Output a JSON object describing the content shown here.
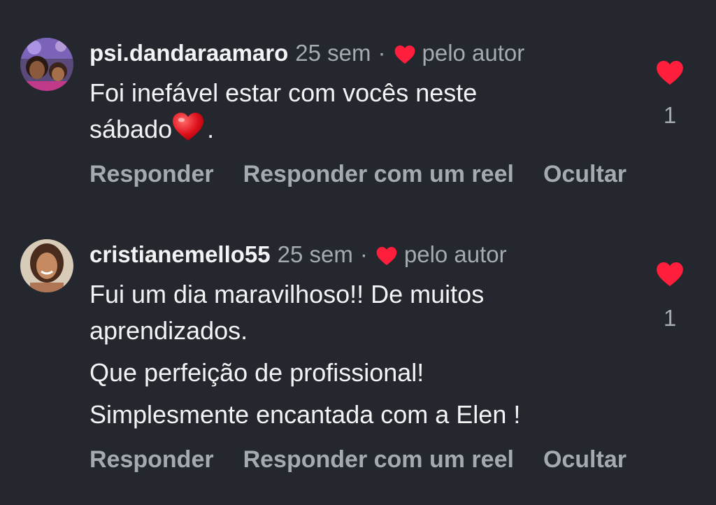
{
  "comments": [
    {
      "username": "psi.dandaraamaro",
      "time": "25 sem",
      "separator": "·",
      "author_like_label": "pelo autor",
      "lines": [
        "Foi inefável estar com vocês neste",
        "sábado"
      ],
      "line_suffix": ".",
      "like_count": "1",
      "actions": {
        "reply": "Responder",
        "reply_reel": "Responder com um reel",
        "hide": "Ocultar"
      }
    },
    {
      "username": "cristianemello55",
      "time": "25 sem",
      "separator": "·",
      "author_like_label": "pelo autor",
      "lines": [
        "Fui um dia maravilhoso!! De muitos",
        "aprendizados.",
        "Que perfeição de profissional!",
        "Simplesmente encantada com a Elen !"
      ],
      "like_count": "1",
      "actions": {
        "reply": "Responder",
        "reply_reel": "Responder com um reel",
        "hide": "Ocultar"
      }
    }
  ],
  "colors": {
    "background": "#24272d",
    "primary_text": "#f2f3f5",
    "secondary_text": "#a4a9b2",
    "heart": "#ff1f3d"
  },
  "icons": {
    "author_like": "heart-icon",
    "like": "heart-icon",
    "emoji": "red-heart-emoji"
  }
}
